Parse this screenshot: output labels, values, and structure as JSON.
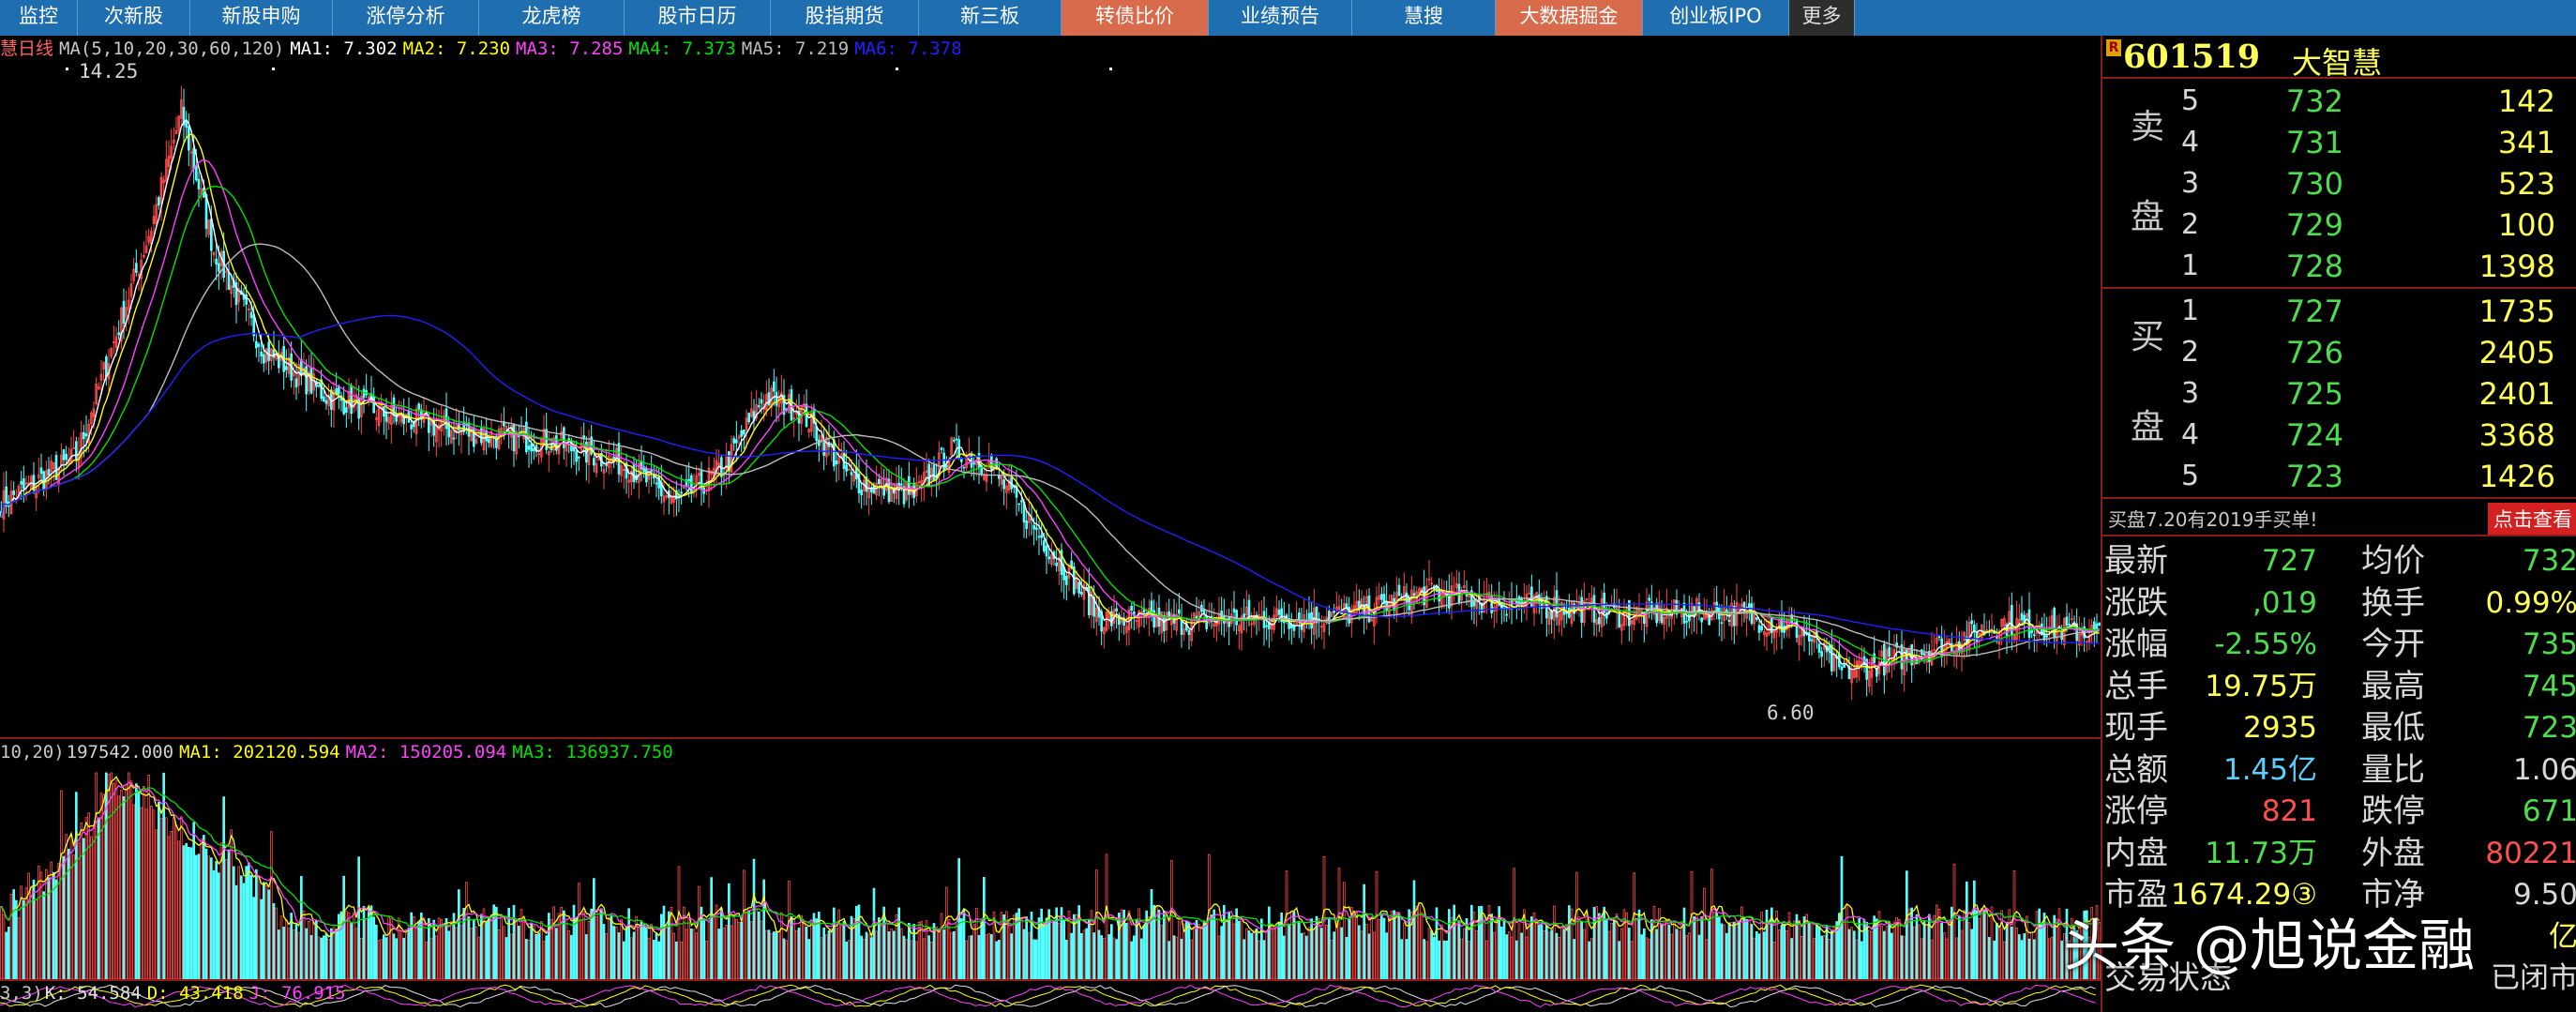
{
  "nav": {
    "tabs": [
      {
        "label": "监控",
        "w": 83,
        "hl": false
      },
      {
        "label": "次新股",
        "w": 120,
        "hl": false
      },
      {
        "label": "新股申购",
        "w": 152,
        "hl": false
      },
      {
        "label": "涨停分析",
        "w": 156,
        "hl": false
      },
      {
        "label": "龙虎榜",
        "w": 155,
        "hl": false
      },
      {
        "label": "股市日历",
        "w": 156,
        "hl": false
      },
      {
        "label": "股指期货",
        "w": 158,
        "hl": false
      },
      {
        "label": "新三板",
        "w": 152,
        "hl": false
      },
      {
        "label": "转债比价",
        "w": 157,
        "hl": true
      },
      {
        "label": "业绩预告",
        "w": 153,
        "hl": false
      },
      {
        "label": "慧搜",
        "w": 153,
        "hl": false
      },
      {
        "label": "大数据掘金",
        "w": 157,
        "hl": true
      },
      {
        "label": "创业板IPO",
        "w": 156,
        "hl": false
      },
      {
        "label": "更多",
        "w": 70,
        "hl": false,
        "more": true
      }
    ]
  },
  "kline": {
    "legend": {
      "name": "慧日线",
      "ma_def": "MA(5,10,20,30,60,120)",
      "ma1": "MA1: 7.302",
      "ma2": "MA2: 7.230",
      "ma3": "MA3: 7.285",
      "ma4": "MA4: 7.373",
      "ma5": "MA5: 7.219",
      "ma6": "MA6: 7.378"
    },
    "high_label": "14.25",
    "low_label": "6.60",
    "colors": {
      "up": "#ff4a4a",
      "down": "#54ffff",
      "ma1": "#ffffff",
      "ma2": "#ffff00",
      "ma3": "#ff40ff",
      "ma4": "#00e000",
      "ma5": "#bdbdbd",
      "ma6": "#2020ff"
    }
  },
  "volume": {
    "legend": {
      "def": "10,20)",
      "vol": "197542.000",
      "ma1": "MA1: 202120.594",
      "ma2": "MA2: 150205.094",
      "ma3": "MA3: 136937.750"
    }
  },
  "kdj": {
    "legend": {
      "def": "3,3)",
      "k": "K: 54.584",
      "d": "D: 43.418",
      "j": "J: 76.915"
    }
  },
  "quote": {
    "code": "601519",
    "name": "大智慧",
    "sell_char_1": "卖",
    "sell_char_2": "盘",
    "buy_char_1": "买",
    "buy_char_2": "盘",
    "sell": [
      {
        "level": "5",
        "price": "732",
        "vol": "142"
      },
      {
        "level": "4",
        "price": "731",
        "vol": "341"
      },
      {
        "level": "3",
        "price": "730",
        "vol": "523"
      },
      {
        "level": "2",
        "price": "729",
        "vol": "100"
      },
      {
        "level": "1",
        "price": "728",
        "vol": "1398"
      }
    ],
    "buy": [
      {
        "level": "1",
        "price": "727",
        "vol": "1735"
      },
      {
        "level": "2",
        "price": "726",
        "vol": "2405"
      },
      {
        "level": "3",
        "price": "725",
        "vol": "2401"
      },
      {
        "level": "4",
        "price": "724",
        "vol": "3368"
      },
      {
        "level": "5",
        "price": "723",
        "vol": "1426"
      }
    ],
    "message": "买盘7.20有2019手买单!",
    "message_btn": "点击查看",
    "stats": [
      {
        "l1": "最新",
        "v1": "727",
        "c1": "#4cde4c",
        "l2": "均价",
        "v2": "732",
        "c2": "#4cde4c"
      },
      {
        "l1": "涨跌",
        "v1": ",019",
        "c1": "#4cde4c",
        "l2": "换手",
        "v2": "0.99%",
        "c2": "#ffff54"
      },
      {
        "l1": "涨幅",
        "v1": "-2.55%",
        "c1": "#4cde4c",
        "l2": "今开",
        "v2": "735",
        "c2": "#4cde4c"
      },
      {
        "l1": "总手",
        "v1": "19.75万",
        "c1": "#ffff54",
        "l2": "最高",
        "v2": "745",
        "c2": "#4cde4c"
      },
      {
        "l1": "现手",
        "v1": "2935",
        "c1": "#ffff54",
        "l2": "最低",
        "v2": "723",
        "c2": "#4cde4c"
      },
      {
        "l1": "总额",
        "v1": "1.45亿",
        "c1": "#5ad0ff",
        "l2": "量比",
        "v2": "1.06",
        "c2": "#d8d8d8"
      },
      {
        "l1": "涨停",
        "v1": "821",
        "c1": "#ff5050",
        "l2": "跌停",
        "v2": "671",
        "c2": "#4cde4c"
      },
      {
        "l1": "内盘",
        "v1": "11.73万",
        "c1": "#4cde4c",
        "l2": "外盘",
        "v2": "80221",
        "c2": "#ff5050"
      },
      {
        "l1": "市盈",
        "v1": "1674.29③",
        "c1": "#ffff54",
        "l2": "市净",
        "v2": "9.50",
        "c2": "#d8d8d8"
      },
      {
        "l1": "",
        "v1": "",
        "c1": "#ffff54",
        "l2": "",
        "v2": "亿",
        "c2": "#ffff54"
      },
      {
        "l1": "交易状态",
        "v1": "",
        "c1": "#d8d8d8",
        "l2": "",
        "v2": "已闭市",
        "c2": "#d8d8d8"
      }
    ]
  },
  "watermark": "头条 @旭说金融"
}
